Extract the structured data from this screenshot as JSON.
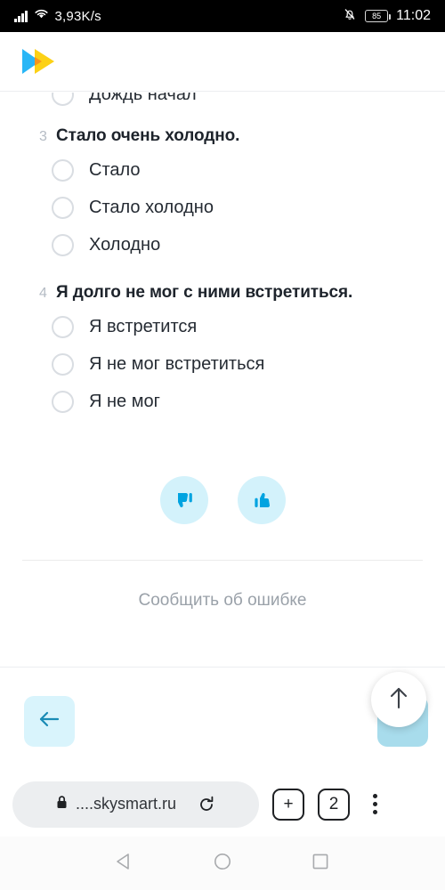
{
  "status_bar": {
    "network_speed": "3,93K/s",
    "battery_level": "85",
    "time": "11:02",
    "icons": [
      "signal-bars-icon",
      "wifi-icon",
      "bell-muted-icon",
      "battery-icon"
    ]
  },
  "app_header": {
    "logo_name": "skysmart-logo"
  },
  "content": {
    "clipped_option": {
      "label": "Дождь начал"
    },
    "questions": [
      {
        "number": "3",
        "text": "Стало очень холодно.",
        "options": [
          "Стало",
          "Стало холодно",
          "Холодно"
        ]
      },
      {
        "number": "4",
        "text": "Я долго не мог с ними встретиться.",
        "options": [
          "Я встретится",
          "Я не мог встретиться",
          "Я не мог"
        ]
      }
    ],
    "feedback": {
      "dislike_name": "thumbs-down-icon",
      "like_name": "thumbs-up-icon"
    },
    "report_error_label": "Сообщить об ошибке"
  },
  "bottom_nav": {
    "prev_icon": "arrow-left-icon",
    "next_icon": "arrow-right-icon",
    "scroll_top_icon": "arrow-up-icon"
  },
  "browser_bar": {
    "lock_icon": "lock-icon",
    "url": "....skysmart.ru",
    "reload_icon": "reload-icon",
    "new_tab_label": "+",
    "tab_count": "2",
    "menu_icon": "more-vertical-icon"
  },
  "android_nav": {
    "back": "back-triangle-icon",
    "home": "home-circle-icon",
    "recents": "recents-square-icon"
  },
  "colors": {
    "accent_cyan": "#00a3e0",
    "light_cyan": "#d3f2fb",
    "button_cyan": "#d9f4fc",
    "next_cyan": "#a8dcec",
    "text_dark": "#1d232b",
    "text_gray": "#9aa1a9",
    "radio_border": "#d9dde2"
  }
}
